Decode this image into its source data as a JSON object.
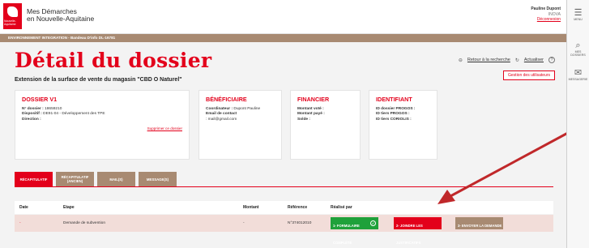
{
  "header": {
    "brand_line1": "Mes Démarches",
    "brand_line2": "en Nouvelle-Aquitaine",
    "logo_text": "Nouvelle-Aquitaine",
    "user_name": "Pauline Dupont",
    "user_org": "INOVA",
    "logout_label": "Déconnexion"
  },
  "banner": "ENVIRONNEMENT INTEGRATION - Bandeau D'info DL-16781",
  "page": {
    "title": "Détail du dossier",
    "subtitle": "Extension de la surface de vente du magasin \"CBD O Naturel\"",
    "back_link": "Retour à la recherche",
    "refresh_link": "Actualiser",
    "help_label": "?",
    "manage_users_button": "Gestion des utilisateurs"
  },
  "cards": {
    "dossier": {
      "title": "DOSSIER V1",
      "num_label": "N° dossier :",
      "num_value": "18659210",
      "dispositif_label": "Dispositif :",
      "dispositif_value": "DE91-04 - Développement des TPE",
      "direction_label": "Direction :",
      "delete_link": "Supprimer ce dossier"
    },
    "beneficiaire": {
      "title": "BÉNÉFICIAIRE",
      "coord_label": "Coordinateur :",
      "coord_value": "Dupont Pauline",
      "email_label": "Email de contact",
      "email_value": ": mail@gmail.com"
    },
    "financier": {
      "title": "FINANCIER",
      "vote_label": "Montant voté :",
      "paye_label": "Montant payé :",
      "solde_label": "Solde :"
    },
    "identifiant": {
      "title": "IDENTIFIANT",
      "progos_label": "ID dossier PROGOS :",
      "tiers_progos_label": "ID tiers PROGOS :",
      "coriolis_label": "ID tiers CORIOLIS :"
    }
  },
  "tabs": [
    {
      "label": "RÉCAPITULATIF"
    },
    {
      "label": "RÉCAPITULATIF (ANCIEN)"
    },
    {
      "label": "MAIL(S)"
    },
    {
      "label": "MESSAGE(S)"
    }
  ],
  "table": {
    "headers": {
      "date": "Date",
      "etape": "Etape",
      "montant": "Montant",
      "reference": "Référence",
      "realise": "Réalisé par"
    },
    "row": {
      "date": "-",
      "etape": "Demande de subvention",
      "montant": "-",
      "reference": "N°374012010",
      "step1": "1- FORMULAIRE COMPLÉTÉ",
      "step2": "2- JOINDRE LES JUSTIFICATIFS",
      "step3": "3- ENVOYER LA DEMANDE"
    }
  },
  "sidebar": {
    "menu_label": "MENU",
    "search_label": "MES DOSSIERS",
    "messages_label": "MESSAGERIE"
  },
  "colors": {
    "accent": "#e3001b",
    "taupe": "#a88a72",
    "success": "#1fa13a",
    "arrow": "#c0282a"
  }
}
